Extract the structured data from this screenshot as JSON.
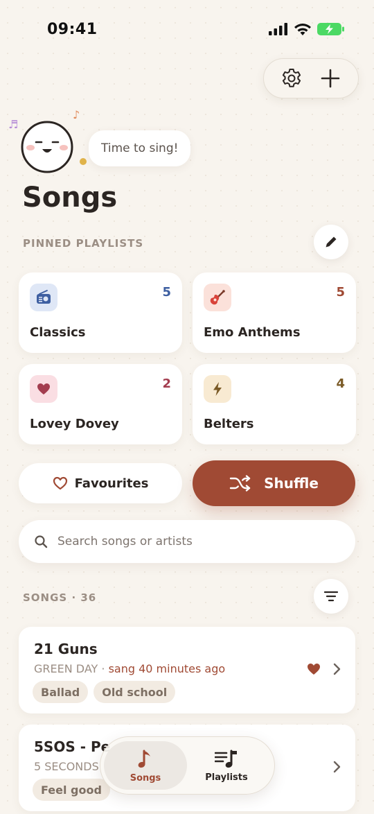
{
  "status": {
    "time": "09:41"
  },
  "mascot": {
    "greeting": "Time to sing!"
  },
  "page_title": "Songs",
  "pinned": {
    "label": "PINNED PLAYLISTS",
    "playlists": [
      {
        "name": "Classics",
        "count": "5",
        "icon": "radio-icon",
        "color": "#3e5fa1",
        "bg": "#dfe7f6"
      },
      {
        "name": "Emo Anthems",
        "count": "5",
        "icon": "guitar-icon",
        "color": "#a04a34",
        "bg": "#fbe1da"
      },
      {
        "name": "Lovey Dovey",
        "count": "2",
        "icon": "heart-icon",
        "color": "#a33d4f",
        "bg": "#fadee3"
      },
      {
        "name": "Belters",
        "count": "4",
        "icon": "bolt-icon",
        "color": "#7a5a26",
        "bg": "#f8ead2"
      }
    ]
  },
  "actions": {
    "favourites": "Favourites",
    "shuffle": "Shuffle"
  },
  "search": {
    "placeholder": "Search songs or artists"
  },
  "songs_section": {
    "label": "SONGS · 36"
  },
  "songs": [
    {
      "title": "21 Guns",
      "artist": "GREEN DAY",
      "separator": " · ",
      "last_sung": "sang 40 minutes ago",
      "favourite": true,
      "tags": [
        "Ballad",
        "Old school"
      ]
    },
    {
      "title": "5SOS - Pe",
      "artist": "5 SECONDS",
      "tags": [
        "Feel good"
      ]
    }
  ],
  "nav": {
    "songs": "Songs",
    "playlists": "Playlists"
  },
  "colors": {
    "accent": "#a04a34",
    "background": "#f8f4ee"
  }
}
